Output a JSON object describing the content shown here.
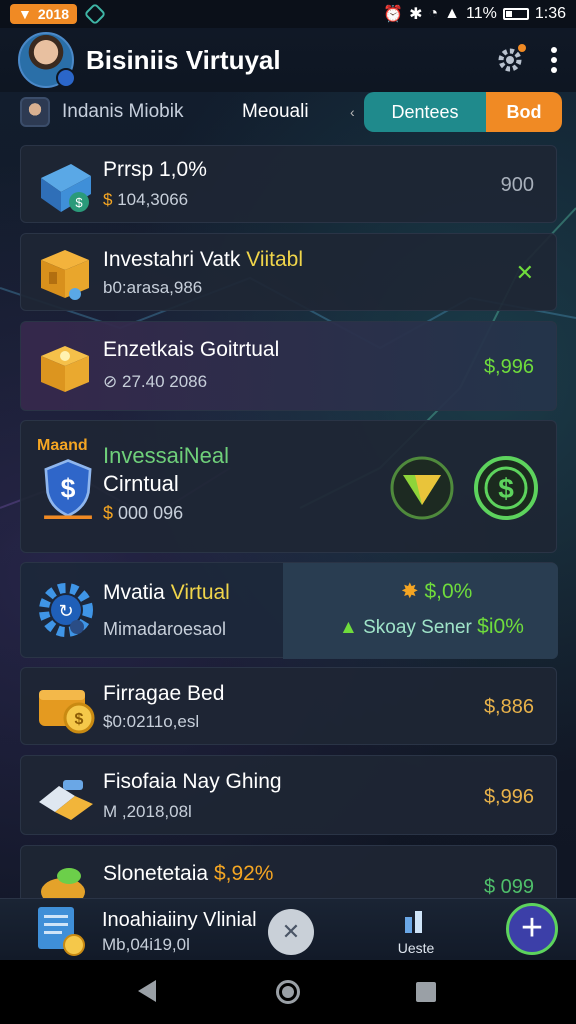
{
  "status_bar": {
    "badge": "2018",
    "battery": "11%",
    "time": "1:36"
  },
  "header": {
    "title": "Bisiniis Virtuyal"
  },
  "tabs": {
    "user_label": "Indanis Miobik",
    "current": "Meouali",
    "teal_pill": "Dentees",
    "orange_pill": "Bod"
  },
  "cards": [
    {
      "title": "Prrsp 1,0%",
      "sub_prefix": "$",
      "sub": "104,3066",
      "value": "900"
    },
    {
      "title": "Investahri Vatk",
      "title_accent": "Viitabl",
      "sub": "b0:arasa,986"
    },
    {
      "title": "Enzetkais Goitrtual",
      "sub": "27.40 2086",
      "value": "$,996"
    },
    {
      "tag": "Maand",
      "title": "InvessaiNeal",
      "title2": "Cirntual",
      "sub_prefix": "$",
      "sub": "000 096"
    },
    {
      "title": "Mvatia",
      "title_accent": "Virtual",
      "sub": "Mimadaroesaol",
      "stat": "$,0%",
      "stat2_label": "Skoay Sener",
      "stat2_value": "$i0%"
    },
    {
      "title": "Firragae Bed",
      "sub": "$0:0211o,esl",
      "value": "$,886"
    },
    {
      "title": "Fisofaia Nay Ghing",
      "sub": "M ,2018,08l",
      "value": "$,996"
    },
    {
      "title": "Slonetetaia",
      "title_accent": "$,92%",
      "value": "$ 099"
    }
  ],
  "bottom_bar": {
    "title": "Inoahiaiiny Vlinial",
    "sub": "Mb,04i19,0l",
    "stats_label": "Ueste"
  },
  "colors": {
    "accent_orange": "#f08a24",
    "accent_teal": "#1f8a8c",
    "accent_green": "#6fdc3c",
    "card_bg": "#1e2634"
  }
}
